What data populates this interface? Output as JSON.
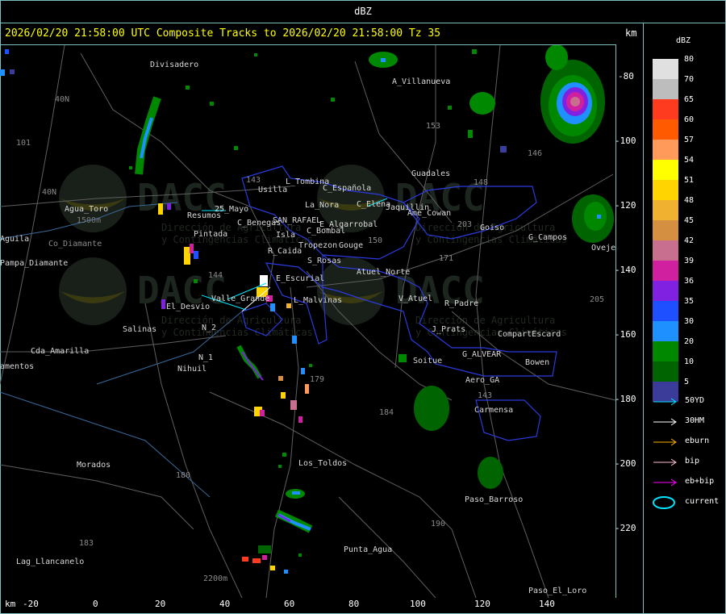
{
  "window": {
    "title": "dBZ"
  },
  "header": {
    "title": "2026/02/20 21:58:00 UTC Composite Tracks to 2026/02/20 21:58:00 Tz 35",
    "km_label": "km"
  },
  "legend": {
    "title": "dBZ",
    "levels": [
      {
        "value": "80",
        "color": "#e0e0e0"
      },
      {
        "value": "70",
        "color": "#bdbdbd"
      },
      {
        "value": "65",
        "color": "#ff3b1f"
      },
      {
        "value": "60",
        "color": "#ff5a00"
      },
      {
        "value": "57",
        "color": "#ff9a5a"
      },
      {
        "value": "54",
        "color": "#ffff00"
      },
      {
        "value": "51",
        "color": "#ffd400"
      },
      {
        "value": "48",
        "color": "#f0b030"
      },
      {
        "value": "45",
        "color": "#d49040"
      },
      {
        "value": "42",
        "color": "#c86e8e"
      },
      {
        "value": "39",
        "color": "#d020a0"
      },
      {
        "value": "36",
        "color": "#8020e0"
      },
      {
        "value": "35",
        "color": "#1e50ff"
      },
      {
        "value": "30",
        "color": "#1e90ff"
      },
      {
        "value": "20",
        "color": "#008800"
      },
      {
        "value": "10",
        "color": "#006400"
      },
      {
        "value": "5",
        "color": "#3b3b9a"
      }
    ],
    "tracks": [
      {
        "label": "50YD",
        "color": "#00e5ff"
      },
      {
        "label": "30HM",
        "color": "#ffffff"
      },
      {
        "label": "eburn",
        "color": "#ffb000"
      },
      {
        "label": "bip",
        "color": "#ffc0d0"
      },
      {
        "label": "eb+bip",
        "color": "#ff00ff"
      },
      {
        "label": "current",
        "color": "#00e5ff"
      }
    ]
  },
  "axes": {
    "x_unit": "km",
    "x_ticks": [
      "-20",
      "0",
      "20",
      "40",
      "60",
      "80",
      "100",
      "120",
      "140"
    ],
    "y_ticks": [
      "-80",
      "-100",
      "-120",
      "-140",
      "-160",
      "-180",
      "-200",
      "-220"
    ]
  },
  "watermark": {
    "brand": "DACC",
    "line1": "Dirección de Agricultura",
    "line2": "y Contingencias Climáticas"
  },
  "places": [
    "Divisadero",
    "A_Villanueva",
    "Guadales",
    "L_Tombina",
    "Usilla",
    "C_Española",
    "La_Nora",
    "C_Elena",
    "Jaquillin",
    "Ame_Cowan",
    "Goiso",
    "G_Campos",
    "Oveje",
    "Agua_Toro",
    "1500m",
    "Aguila",
    "Pampa_Diamante",
    "Co_Diamante",
    "Resumos",
    "25_Mayo",
    "C_Benegas",
    "SAN_RAFAEL",
    "E_Algarrobal",
    "C_Bombal",
    "Tropezon",
    "Gouge",
    "Pintada",
    "Isla",
    "R_Caida",
    "S_Rosas",
    "Atuel_Norte",
    "E_Escurial",
    "El_Desvio",
    "Valle_Grande",
    "L_Malvinas",
    "V_Atuel",
    "R_Padre",
    "Salinas",
    "N_2",
    "J_Prats",
    "CompartEscard",
    "G_ALVEAR",
    "Bowen",
    "Cda_Amarilla",
    "N_1",
    "Nihuil",
    "Soitue",
    "Aero_GA",
    "Carmensa",
    "amentos",
    "Los_Toldos",
    "Morados",
    "Paso_Barroso",
    "Punta_Agua",
    "Lag_Llancanelo",
    "2200m",
    "Paso_El_Loro"
  ],
  "road_numbers": [
    "101",
    "40N",
    "153",
    "146",
    "143",
    "148",
    "203",
    "171",
    "205",
    "144",
    "150",
    "179",
    "184",
    "180",
    "183",
    "143",
    "190",
    "40N"
  ]
}
